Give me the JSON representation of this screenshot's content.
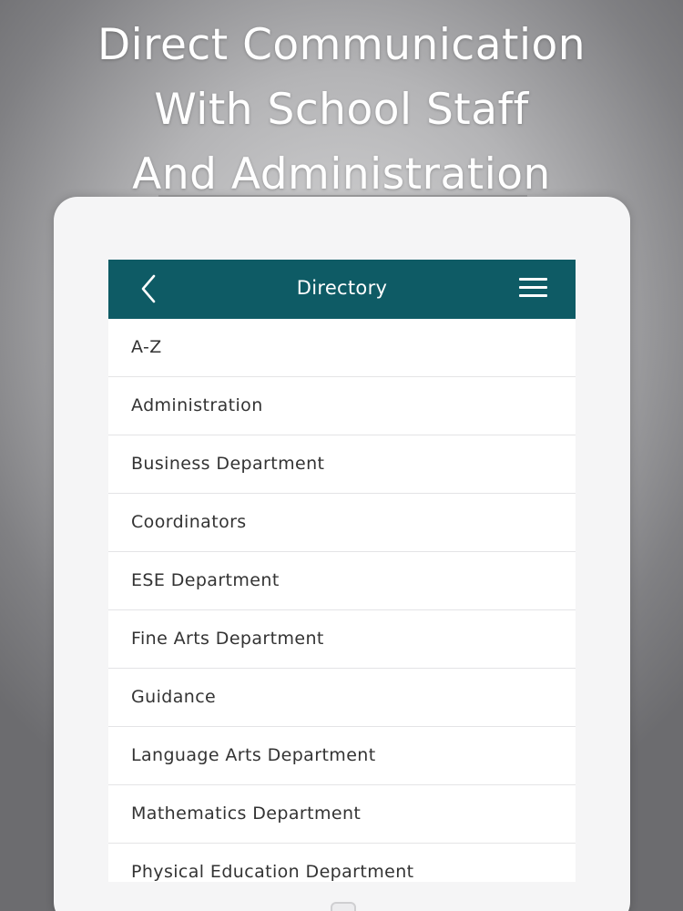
{
  "headline": {
    "line1": "Direct Communication",
    "line2": "With School Staff",
    "line3": "And Administration"
  },
  "header": {
    "title": "Directory",
    "back_icon": "chevron-left-icon",
    "menu_icon": "hamburger-menu-icon"
  },
  "colors": {
    "header_bg": "#0e5b65",
    "header_text": "#ffffff",
    "item_text": "#333333",
    "divider": "#e4e4e6"
  },
  "directory": {
    "items": [
      {
        "label": "A-Z"
      },
      {
        "label": "Administration"
      },
      {
        "label": "Business Department"
      },
      {
        "label": "Coordinators"
      },
      {
        "label": "ESE Department"
      },
      {
        "label": "Fine Arts Department"
      },
      {
        "label": "Guidance"
      },
      {
        "label": "Language Arts Department"
      },
      {
        "label": "Mathematics Department"
      },
      {
        "label": "Physical Education Department"
      }
    ]
  }
}
